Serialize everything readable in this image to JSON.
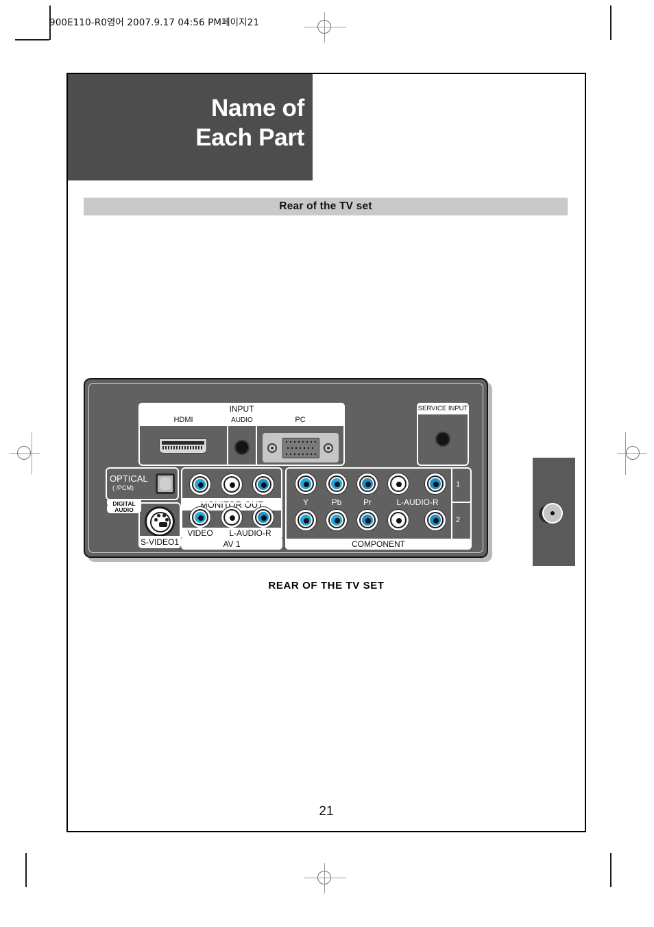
{
  "document": {
    "slug_line": "900E110-R0영어  2007.9.17 04:56 PM페이지21",
    "page_number": "21",
    "chapter_title_line1": "Name of",
    "chapter_title_line2": "Each Part",
    "section_title": "Rear of the TV set",
    "figure_caption": "REAR OF THE TV SET"
  },
  "colors": {
    "title_block_bg": "#4d4d4d",
    "section_bar_bg": "#c9c9c9",
    "panel_bg": "#616161",
    "jack_video_cyan": "#22a7dd",
    "jack_audio_white": "#ffffff",
    "jack_audio_blue": "#1e8fc6",
    "side_tab_bg": "#5a5a5a"
  },
  "diagram": {
    "name": "rear-of-the-tv-set",
    "groups": {
      "input": {
        "title": "INPUT",
        "sub_labels": [
          "HDMI",
          "AUDIO",
          "PC"
        ]
      },
      "service_input": {
        "title": "SERVICE INPUT"
      },
      "optical": {
        "title": "OPTICAL",
        "subtitle": "( /PCM)",
        "footer_line1": "DIGITAL",
        "footer_line2": "AUDIO"
      },
      "monitor_out": {
        "title": "MONITOR OUT",
        "jacks": [
          "video",
          "audio-left",
          "audio-right"
        ]
      },
      "s_video": {
        "title": "S-VIDEO1"
      },
      "av1": {
        "title": "AV 1",
        "sub_labels": [
          "VIDEO",
          "L-AUDIO-R"
        ]
      },
      "component": {
        "title": "COMPONENT",
        "channel_labels": [
          "Y",
          "Pb",
          "Pr",
          "L-AUDIO-R"
        ],
        "row_numbers": [
          "1",
          "2"
        ]
      }
    }
  }
}
